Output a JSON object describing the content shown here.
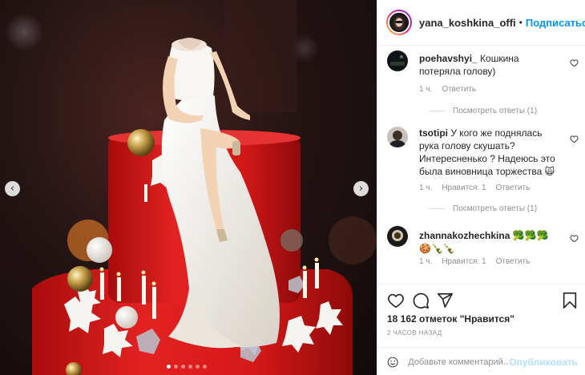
{
  "post": {
    "username": "yana_koshkina_offi",
    "separator": "•",
    "follow_label": "Подписаться",
    "more_label": "•••",
    "nav_prev": "‹",
    "nav_next": "›",
    "slide_count": 6,
    "active_slide": 1
  },
  "comments": [
    {
      "username": "poehavshyi_",
      "text": "Кошкина потеряла голову)",
      "time": "1 ч.",
      "likes": "",
      "reply_label": "Ответить",
      "view_replies": "Посмотреть ответы (1)"
    },
    {
      "username": "tsotipi",
      "text": "У кого же поднялась рука голову скушать? Интересненько ? Надеюсь это была виновница торжества 🙀",
      "time": "1 ч.",
      "likes": "Нравится: 1",
      "reply_label": "Ответить",
      "view_replies": "Посмотреть ответы (1)"
    },
    {
      "username": "zhannakozhechkina",
      "text": "🥦🥦🥦🍪🍾🍾",
      "time": "1 ч.",
      "likes": "Нравится: 1",
      "reply_label": "Ответить",
      "view_replies": ""
    }
  ],
  "actions": {
    "likes_text": "18 162 отметок \"Нравится\"",
    "time_ago": "2 ЧАСОВ НАЗАД",
    "comment_placeholder": "Добавьте комментарий...",
    "post_label": "Опубликовать"
  },
  "colors": {
    "accent": "#0095f6",
    "cake_red": "#d81e1e",
    "dress_white": "#f4f1ec"
  },
  "icons": [
    "heart-icon",
    "comment-icon",
    "share-icon",
    "bookmark-icon",
    "emoji-icon",
    "chevron-left-icon",
    "chevron-right-icon"
  ]
}
